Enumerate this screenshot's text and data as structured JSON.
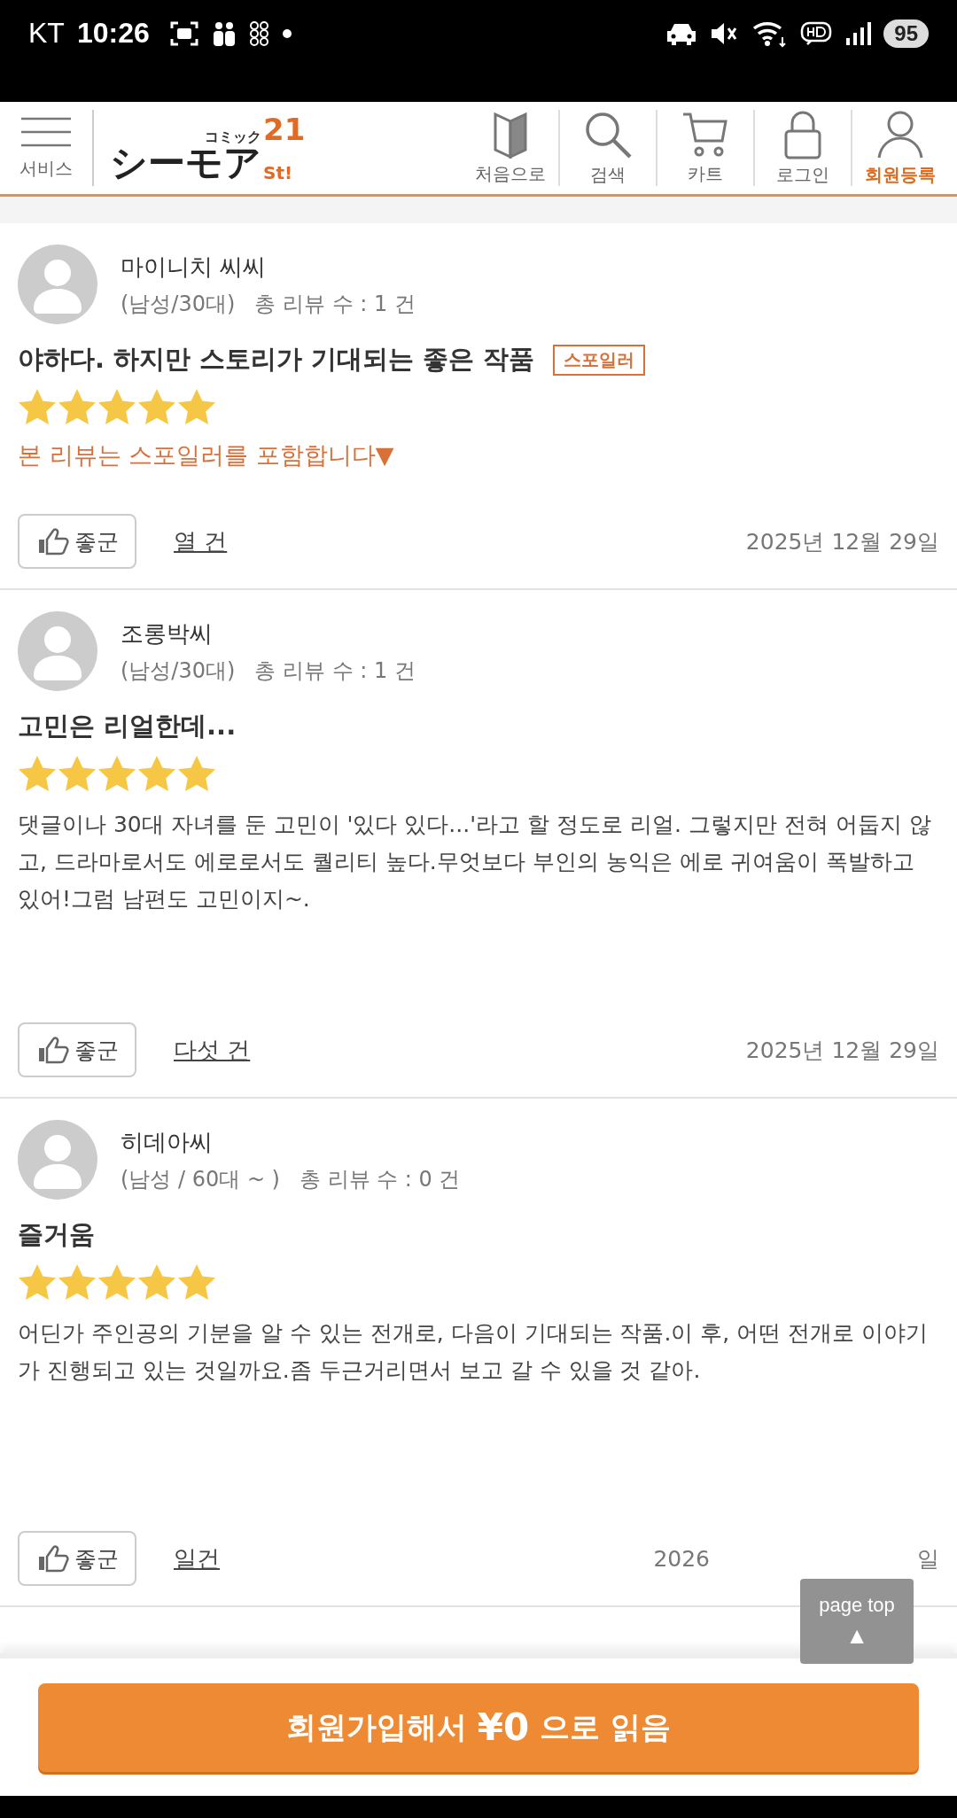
{
  "status_bar": {
    "carrier": "KT",
    "time": "10:26",
    "battery": "95"
  },
  "header": {
    "menu_label": "서비스",
    "logo": {
      "small": "コミック",
      "main": "シーモア",
      "num": "21",
      "sub": "St!"
    },
    "nav": [
      {
        "label": "처음으로",
        "kind": "beginner",
        "highlight": false
      },
      {
        "label": "검색",
        "kind": "search",
        "highlight": false
      },
      {
        "label": "카트",
        "kind": "cart",
        "highlight": false
      },
      {
        "label": "로그인",
        "kind": "lock",
        "highlight": false
      },
      {
        "label": "회원등록",
        "kind": "user",
        "highlight": true
      }
    ]
  },
  "reviews": [
    {
      "name": "마이니치 씨씨",
      "meta": "(남성/30대)",
      "count": "총 리뷰 수 : 1 건",
      "title": "야하다. 하지만 스토리가 기대되는 좋은 작품",
      "tag": "스포일러",
      "stars": 5,
      "spoiler_note": "본 리뷰는 스포일러를 포함합니다▼",
      "like": "좋군",
      "votes": "열 건",
      "date": "2025년 12월 29일"
    },
    {
      "name": "조롱박씨",
      "meta": "(남성/30대)",
      "count": "총 리뷰 수 : 1 건",
      "title": "고민은 리얼한데...",
      "stars": 5,
      "body": "댓글이나 30대 자녀를 둔 고민이 '있다 있다...'라고 할 정도로 리얼. 그렇지만 전혀 어둡지 않고, 드라마로서도 에로로서도 퀄리티 높다.무엇보다 부인의 농익은 에로 귀여움이 폭발하고 있어!그럼 남편도 고민이지~.",
      "like": "좋군",
      "votes": "다섯 건",
      "date": "2025년 12월 29일"
    },
    {
      "name": "히데아씨",
      "meta": "(남성 / 60대 ~ )",
      "count": "총 리뷰 수 : 0 건",
      "title": "즐거움",
      "stars": 5,
      "body": "어딘가 주인공의 기분을 알 수 있는 전개로, 다음이 기대되는 작품.이 후, 어떤 전개로 이야기가 진행되고 있는 것일까요.좀 두근거리면서 보고 갈 수 있을 것 같아.",
      "like": "좋군",
      "votes": "일건",
      "date_start": "2026",
      "date_end": "일"
    }
  ],
  "page_top": {
    "label": "page top",
    "arrow": "▲"
  },
  "cta": {
    "before": "회원가입해서",
    "price": "¥0",
    "after": "으로 읽음"
  }
}
